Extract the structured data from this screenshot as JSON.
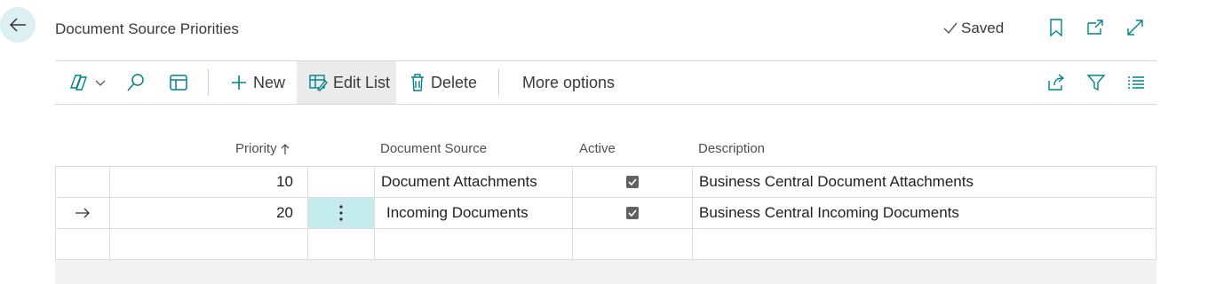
{
  "header": {
    "title": "Document Source Priorities",
    "saved_label": "Saved"
  },
  "toolbar": {
    "new_label": "New",
    "edit_list_label": "Edit List",
    "delete_label": "Delete",
    "more_options_label": "More options"
  },
  "table": {
    "columns": {
      "priority": "Priority",
      "document_source": "Document Source",
      "active": "Active",
      "description": "Description"
    },
    "rows": [
      {
        "priority": "10",
        "document_source": "Document Attachments",
        "active": true,
        "description": "Business Central Document Attachments",
        "selected": false
      },
      {
        "priority": "20",
        "document_source": "Incoming Documents",
        "active": true,
        "description": "Business Central Incoming Documents",
        "selected": true
      },
      {
        "priority": "",
        "document_source": "",
        "active": false,
        "description": "",
        "selected": false
      }
    ]
  },
  "colors": {
    "accent": "#008489",
    "selected_cell": "#c4ecef",
    "back_button_bg": "#dcf0f2"
  }
}
